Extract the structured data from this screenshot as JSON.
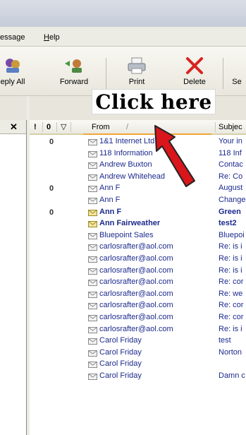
{
  "menu": {
    "message": "essage",
    "help_prefix": "H",
    "help_rest": "elp"
  },
  "toolbar": {
    "reply_all": "eply All",
    "forward": "Forward",
    "print": "Print",
    "delete": "Delete",
    "send": "Se"
  },
  "callout": {
    "text": "Click here"
  },
  "header": {
    "priority": "!",
    "attachment": "0",
    "flag": "▽",
    "from": "From",
    "sort": "/",
    "subject": "Subjec"
  },
  "rows": [
    {
      "clip": "0",
      "from": "1&1 Internet Ltd",
      "subject": "Your in",
      "unread": false,
      "env": "closed"
    },
    {
      "clip": "",
      "from": "118 Information",
      "subject": "118 Inf",
      "unread": false,
      "env": "closed"
    },
    {
      "clip": "",
      "from": "Andrew Buxton",
      "subject": "Contac",
      "unread": false,
      "env": "closed"
    },
    {
      "clip": "",
      "from": "Andrew Whitehead",
      "subject": "Re: Co",
      "unread": false,
      "env": "closed"
    },
    {
      "clip": "0",
      "from": "Ann F",
      "subject": "August",
      "unread": false,
      "env": "closed"
    },
    {
      "clip": "",
      "from": "Ann F",
      "subject": "Change",
      "unread": false,
      "env": "closed"
    },
    {
      "clip": "0",
      "from": "Ann F",
      "subject": "Green",
      "unread": true,
      "env": "open"
    },
    {
      "clip": "",
      "from": "Ann Fairweather",
      "subject": "test2",
      "unread": true,
      "env": "open"
    },
    {
      "clip": "",
      "from": "Bluepoint Sales",
      "subject": "Bluepoi",
      "unread": false,
      "env": "closed"
    },
    {
      "clip": "",
      "from": "carlosrafter@aol.com",
      "subject": "Re: is i",
      "unread": false,
      "env": "closed"
    },
    {
      "clip": "",
      "from": "carlosrafter@aol.com",
      "subject": "Re: is i",
      "unread": false,
      "env": "closed"
    },
    {
      "clip": "",
      "from": "carlosrafter@aol.com",
      "subject": "Re: is i",
      "unread": false,
      "env": "closed"
    },
    {
      "clip": "",
      "from": "carlosrafter@aol.com",
      "subject": "Re: cor",
      "unread": false,
      "env": "closed"
    },
    {
      "clip": "",
      "from": "carlosrafter@aol.com",
      "subject": "Re: we",
      "unread": false,
      "env": "closed"
    },
    {
      "clip": "",
      "from": "carlosrafter@aol.com",
      "subject": "Re: cor",
      "unread": false,
      "env": "closed"
    },
    {
      "clip": "",
      "from": "carlosrafter@aol.com",
      "subject": "Re: cor",
      "unread": false,
      "env": "closed"
    },
    {
      "clip": "",
      "from": "carlosrafter@aol.com",
      "subject": "Re: is i",
      "unread": false,
      "env": "closed"
    },
    {
      "clip": "",
      "from": "Carol Friday",
      "subject": "test",
      "unread": false,
      "env": "closed"
    },
    {
      "clip": "",
      "from": "Carol Friday",
      "subject": "Norton",
      "unread": false,
      "env": "closed"
    },
    {
      "clip": "",
      "from": "Carol Friday",
      "subject": "",
      "unread": false,
      "env": "closed"
    },
    {
      "clip": "",
      "from": "Carol Friday",
      "subject": "Damn c",
      "unread": false,
      "env": "closed"
    }
  ],
  "colors": {
    "link_text": "#1b2a8c",
    "sort_underline": "#f2a43a",
    "arrow": "#d8161b"
  }
}
